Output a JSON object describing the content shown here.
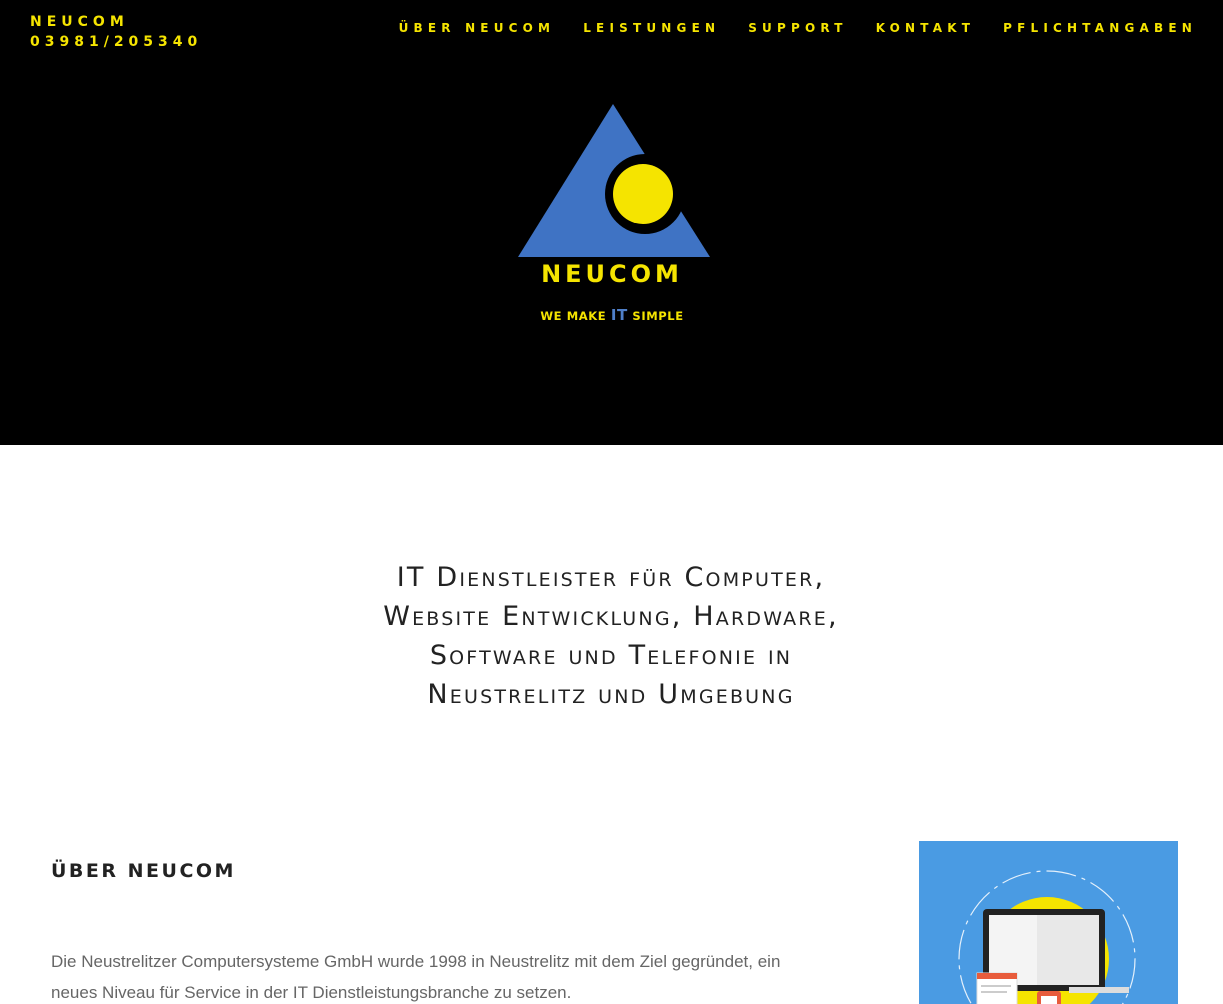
{
  "header": {
    "brand_name": "NEUCOM",
    "phone": "03981/205340",
    "nav": [
      {
        "label": "ÜBER NEUCOM"
      },
      {
        "label": "LEISTUNGEN"
      },
      {
        "label": "SUPPORT"
      },
      {
        "label": "KONTAKT"
      },
      {
        "label": "PFLICHTANGABEN"
      }
    ]
  },
  "hero": {
    "logo_word": "NEUCOM",
    "tagline_pre": "WE MAKE ",
    "tagline_it": "IT",
    "tagline_post": " SIMPLE"
  },
  "headline": {
    "lines": [
      "IT Dienstleister für Computer,",
      "Website Entwicklung, Hardware,",
      "Software und Telefonie in",
      "Neustrelitz und Umgebung"
    ]
  },
  "about": {
    "title": "ÜBER NEUCOM",
    "text": "Die Neustrelitzer Computersysteme GmbH wurde 1998 in Neustrelitz mit dem Ziel gegründet, ein neues Niveau für Service in der IT Dienstleistungsbranche zu setzen."
  },
  "colors": {
    "brand_yellow": "#f5e400",
    "logo_blue": "#3f73c4",
    "hero_background": "#000000",
    "illustration_background": "#4a9be3"
  }
}
